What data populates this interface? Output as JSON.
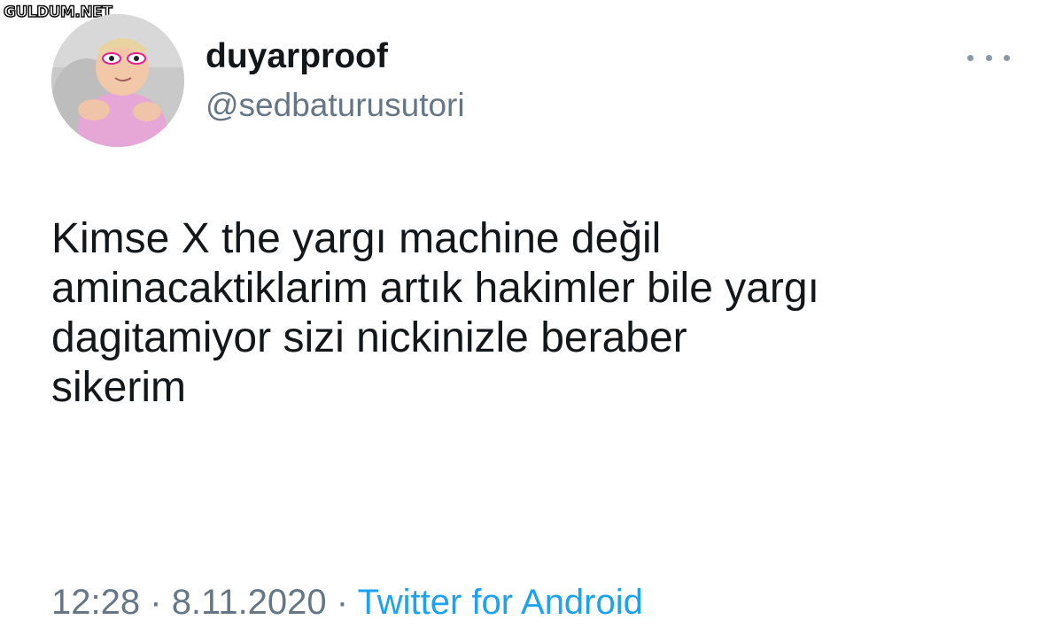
{
  "watermark": "GULDUM.NET",
  "tweet": {
    "display_name": "duyarproof",
    "handle": "@sedbaturusutori",
    "text": "Kimse X the yargı machine değil\naminacaktiklarim artık hakimler bile yargı\ndagitamiyor sizi nickinizle beraber\nsikerim",
    "time": "12:28",
    "separator": "·",
    "date": "8.11.2020",
    "source": "Twitter for Android"
  },
  "icons": {
    "more": "more-horizontal-icon"
  },
  "colors": {
    "text": "#14171a",
    "secondary": "#657786",
    "link": "#1da1f2"
  }
}
